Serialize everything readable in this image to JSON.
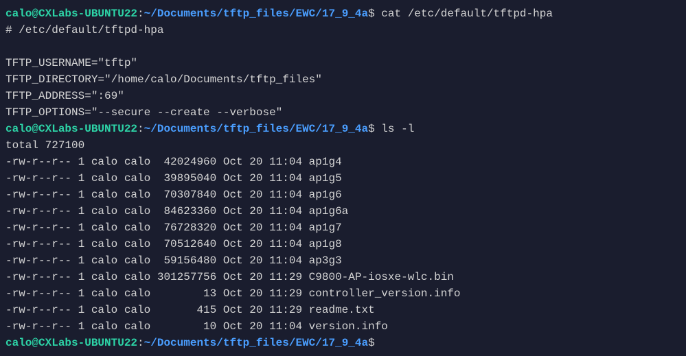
{
  "prompts": [
    {
      "userhost": "calo@CXLabs-UBUNTU22",
      "path": "~/Documents/tftp_files/EWC/17_9_4a",
      "command": "cat /etc/default/tftpd-hpa"
    },
    {
      "userhost": "calo@CXLabs-UBUNTU22",
      "path": "~/Documents/tftp_files/EWC/17_9_4a",
      "command": "ls -l"
    },
    {
      "userhost": "calo@CXLabs-UBUNTU22",
      "path": "~/Documents/tftp_files/EWC/17_9_4a",
      "command": ""
    }
  ],
  "cat_output": {
    "comment": "# /etc/default/tftpd-hpa",
    "blank": "",
    "line1": "TFTP_USERNAME=\"tftp\"",
    "line2": "TFTP_DIRECTORY=\"/home/calo/Documents/tftp_files\"",
    "line3": "TFTP_ADDRESS=\":69\"",
    "line4": "TFTP_OPTIONS=\"--secure --create --verbose\""
  },
  "ls_output": {
    "total": "total 727100",
    "rows": [
      "-rw-r--r-- 1 calo calo  42024960 Oct 20 11:04 ap1g4",
      "-rw-r--r-- 1 calo calo  39895040 Oct 20 11:04 ap1g5",
      "-rw-r--r-- 1 calo calo  70307840 Oct 20 11:04 ap1g6",
      "-rw-r--r-- 1 calo calo  84623360 Oct 20 11:04 ap1g6a",
      "-rw-r--r-- 1 calo calo  76728320 Oct 20 11:04 ap1g7",
      "-rw-r--r-- 1 calo calo  70512640 Oct 20 11:04 ap1g8",
      "-rw-r--r-- 1 calo calo  59156480 Oct 20 11:04 ap3g3",
      "-rw-r--r-- 1 calo calo 301257756 Oct 20 11:29 C9800-AP-iosxe-wlc.bin",
      "-rw-r--r-- 1 calo calo        13 Oct 20 11:29 controller_version.info",
      "-rw-r--r-- 1 calo calo       415 Oct 20 11:29 readme.txt",
      "-rw-r--r-- 1 calo calo        10 Oct 20 11:04 version.info"
    ]
  },
  "sep": {
    "colon": ":",
    "dollar": "$ "
  }
}
